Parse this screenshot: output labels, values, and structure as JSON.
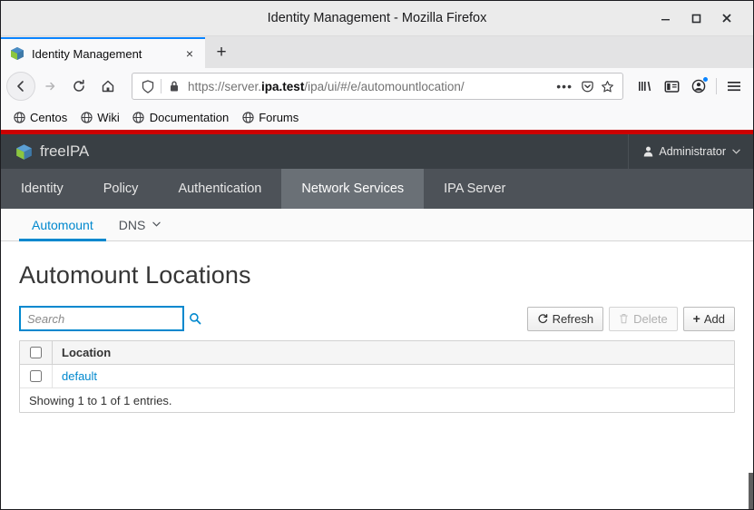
{
  "window": {
    "title": "Identity Management - Mozilla Firefox",
    "minimize_label": "Minimize",
    "maximize_label": "Maximize",
    "close_label": "Close"
  },
  "browser": {
    "tab": {
      "title": "Identity Management",
      "close_label": "×",
      "favicon_name": "freeipa-cube-favicon"
    },
    "new_tab_label": "+",
    "nav": {
      "back_label": "Back",
      "forward_label": "Forward",
      "reload_label": "Reload",
      "home_label": "Home"
    },
    "url": {
      "scheme_prefix": "https://server.",
      "domain": "ipa.test",
      "path": "/ipa/ui/#/e/automountlocation/",
      "full": "https://server.ipa.test/ipa/ui/#/e/automountlocation/",
      "page_actions_label": "•••",
      "shield_label": "Tracking protection",
      "lock_label": "Secure connection",
      "pocket_label": "Save to Pocket",
      "bookmark_label": "Bookmark this page"
    },
    "toolbar_icons": [
      {
        "name": "library-icon",
        "label": "Library"
      },
      {
        "name": "sidebar-icon",
        "label": "Sidebars"
      },
      {
        "name": "account-icon",
        "label": "Account"
      },
      {
        "name": "menu-icon",
        "label": "Open menu"
      }
    ],
    "bookmarks": [
      {
        "label": "Centos",
        "icon": "globe-icon"
      },
      {
        "label": "Wiki",
        "icon": "globe-icon"
      },
      {
        "label": "Documentation",
        "icon": "globe-icon"
      },
      {
        "label": "Forums",
        "icon": "globe-icon"
      }
    ]
  },
  "ipa": {
    "brand": "freeIPA",
    "user": {
      "name": "Administrator",
      "caret": "⌄",
      "icon": "user-icon"
    },
    "primary_nav": [
      {
        "label": "Identity",
        "active": false
      },
      {
        "label": "Policy",
        "active": false
      },
      {
        "label": "Authentication",
        "active": false
      },
      {
        "label": "Network Services",
        "active": true
      },
      {
        "label": "IPA Server",
        "active": false
      }
    ],
    "secondary_nav": [
      {
        "label": "Automount",
        "active": true,
        "caret": ""
      },
      {
        "label": "DNS",
        "active": false,
        "caret": "⌄"
      }
    ]
  },
  "page": {
    "title": "Automount Locations",
    "search": {
      "value": "",
      "placeholder": "Search",
      "icon": "search-icon"
    },
    "actions": [
      {
        "name": "refresh-button",
        "label": "Refresh",
        "icon": "refresh-icon",
        "disabled": false
      },
      {
        "name": "delete-button",
        "label": "Delete",
        "icon": "trash-icon",
        "disabled": true
      },
      {
        "name": "add-button",
        "label": "Add",
        "icon": "plus-icon",
        "disabled": false
      }
    ],
    "table": {
      "columns": [
        "Location"
      ],
      "rows": [
        {
          "location": "default",
          "selected": false
        }
      ],
      "select_all": false,
      "footer": "Showing 1 to 1 of 1 entries."
    }
  },
  "colors": {
    "accent_blue": "#0088ce",
    "header_dark": "#393f44",
    "nav_dark": "#4d5258",
    "nav_active": "#6a7076",
    "red_bar": "#cc0000",
    "tab_accent": "#0a84ff"
  }
}
